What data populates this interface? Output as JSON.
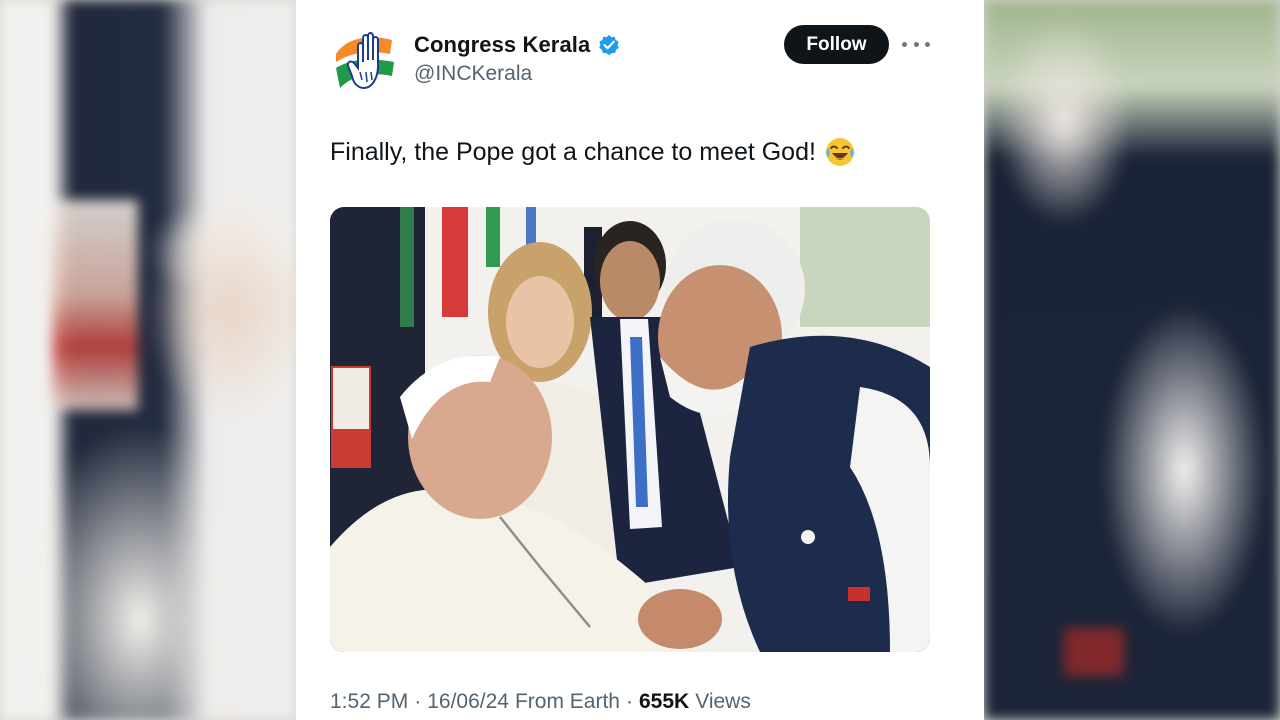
{
  "tweet": {
    "display_name": "Congress Kerala",
    "handle": "@INCKerala",
    "follow_label": "Follow",
    "text": "Finally, the Pope got a chance to meet God!",
    "emoji": "face-with-tears-of-joy-emoji",
    "image_semantic": "photo-pope-greeting-world-leaders",
    "meta": {
      "time": "1:52 PM",
      "dot1": "·",
      "date": "16/06/24",
      "source": "From Earth",
      "dot2": "·",
      "views_count": "655K",
      "views_label": "Views"
    },
    "icons": {
      "verified": "verified-badge-icon",
      "more": "more-options-icon",
      "avatar": "congress-hand-logo"
    }
  },
  "colors": {
    "follow_bg": "#0f1419",
    "verified_blue": "#1d9bf0",
    "secondary_text": "#536471",
    "flag_saffron": "#f58a2a",
    "flag_green": "#1f9a48"
  }
}
